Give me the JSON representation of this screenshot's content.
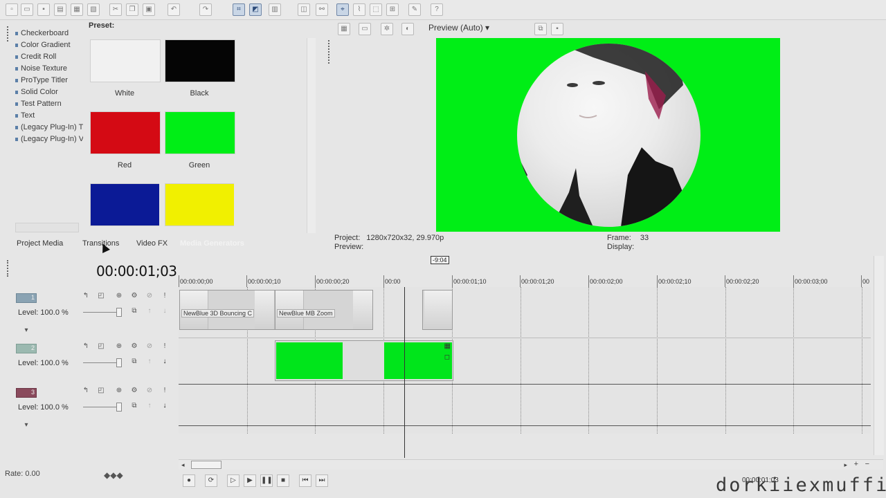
{
  "media_generators": {
    "items": [
      "Checkerboard",
      "Color Gradient",
      "Credit Roll",
      "Noise Texture",
      "ProType Titler",
      "Solid Color",
      "Test Pattern",
      "Text",
      "(Legacy Plug-In) T",
      "(Legacy Plug-In) V"
    ],
    "preset_label": "Preset:",
    "presets": [
      {
        "name": "White",
        "color": "#f1f1f1"
      },
      {
        "name": "Black",
        "color": "#050505"
      },
      {
        "name": "Red",
        "color": "#d40a14"
      },
      {
        "name": "Green",
        "color": "#00ee16"
      },
      {
        "name": "",
        "color": "#0b1a96"
      },
      {
        "name": "",
        "color": "#f1f000"
      }
    ]
  },
  "window_tabs": [
    "Project Media",
    "Transitions",
    "Video FX",
    "Media Generators"
  ],
  "preview": {
    "mode": "Preview (Auto)",
    "project_label": "Project:",
    "project_value": "1280x720x32, 29.970p",
    "preview_label": "Preview:",
    "frame_label": "Frame:",
    "frame_value": "33",
    "display_label": "Display:"
  },
  "timeline": {
    "timecode": "00:00:01;03",
    "marker": "-9:04",
    "ruler": [
      "00:00:00;00",
      "00:00:00;10",
      "00:00:00;20",
      "00:00",
      "00:00:01;10",
      "00:00:01;20",
      "00:00:02;00",
      "00:00:02;10",
      "00:00:02;20",
      "00:00:03;00",
      "00"
    ],
    "tracks": [
      {
        "number": "1",
        "level": "Level: 100.0 %"
      },
      {
        "number": "2",
        "level": "Level: 100.0 %"
      },
      {
        "number": "3",
        "level": "Level: 100.0 %"
      }
    ],
    "clips": [
      "NewBlue 3D Bouncing C",
      "NewBlue MB Zoom"
    ],
    "rate": "Rate: 0.00",
    "bottom_time": "00:00:01;03"
  },
  "watermark": "dorkiiexmuffin",
  "colors": {
    "preview_green": "#00ee16",
    "clip_green": "#00e51b"
  }
}
